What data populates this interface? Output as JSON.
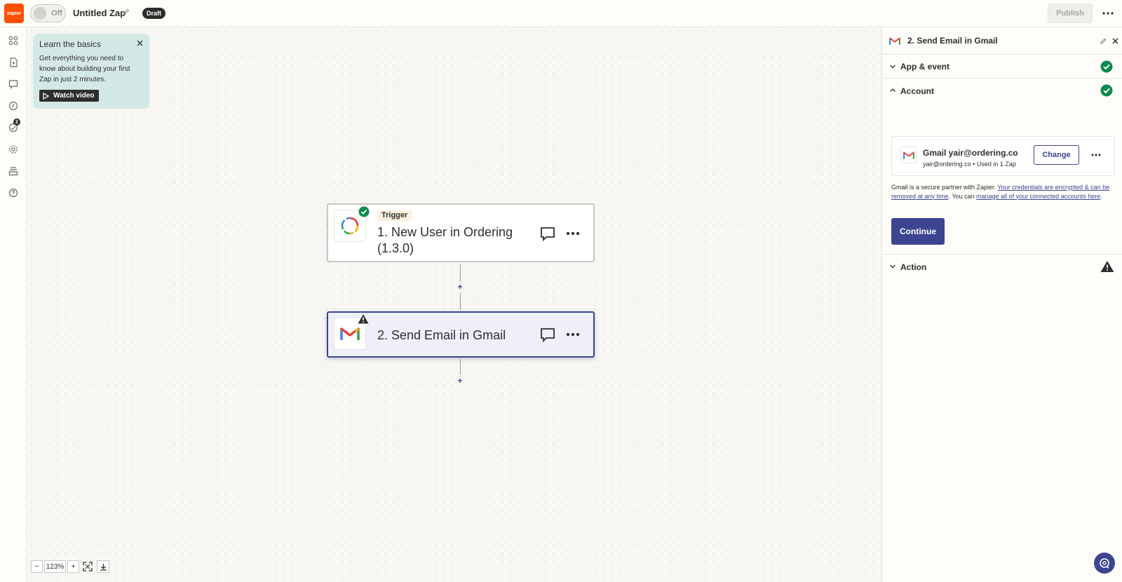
{
  "header": {
    "logo_text": "zapier",
    "toggle_label": "Off",
    "zap_title": "Untitled Zap",
    "status_badge": "Draft",
    "publish_label": "Publish"
  },
  "learn_card": {
    "title": "Learn the basics",
    "body": "Get everything you need to know about building your first Zap in just 2 minutes.",
    "watch_label": "Watch video"
  },
  "rail": {
    "badge_count": "2",
    "icons": [
      "apps-icon",
      "file-icon",
      "comment-icon",
      "history-icon",
      "runs-icon",
      "settings-icon",
      "versions-icon",
      "help-icon"
    ]
  },
  "steps": [
    {
      "tag": "Trigger",
      "title": "1. New User in Ordering (1.3.0)",
      "status": "ok"
    },
    {
      "title": "2. Send Email in Gmail",
      "status": "warning"
    }
  ],
  "canvas_controls": {
    "zoom_out": "−",
    "zoom_level": "123%",
    "zoom_in": "+",
    "add_step": "+"
  },
  "panel": {
    "title": "2. Send Email in Gmail",
    "sections": {
      "app_event": "App & event",
      "account": "Account",
      "action": "Action"
    },
    "account_card": {
      "name": "Gmail yair@ordering.co",
      "sub": "yair@ordering.co • Used in 1 Zap",
      "change_label": "Change"
    },
    "secure_text_1": "Gmail is a secure partner with Zapier. ",
    "secure_link_1": "Your credentials are encrypted & can be removed at any time",
    "secure_text_2": ". You can ",
    "secure_link_2": "manage all of your connected accounts here",
    "secure_text_3": ".",
    "continue_label": "Continue"
  },
  "colors": {
    "brand_orange": "#ff4f00",
    "accent_blue": "#3d4592",
    "success_green": "#0f884e",
    "learn_bg": "#d4e9e5"
  }
}
